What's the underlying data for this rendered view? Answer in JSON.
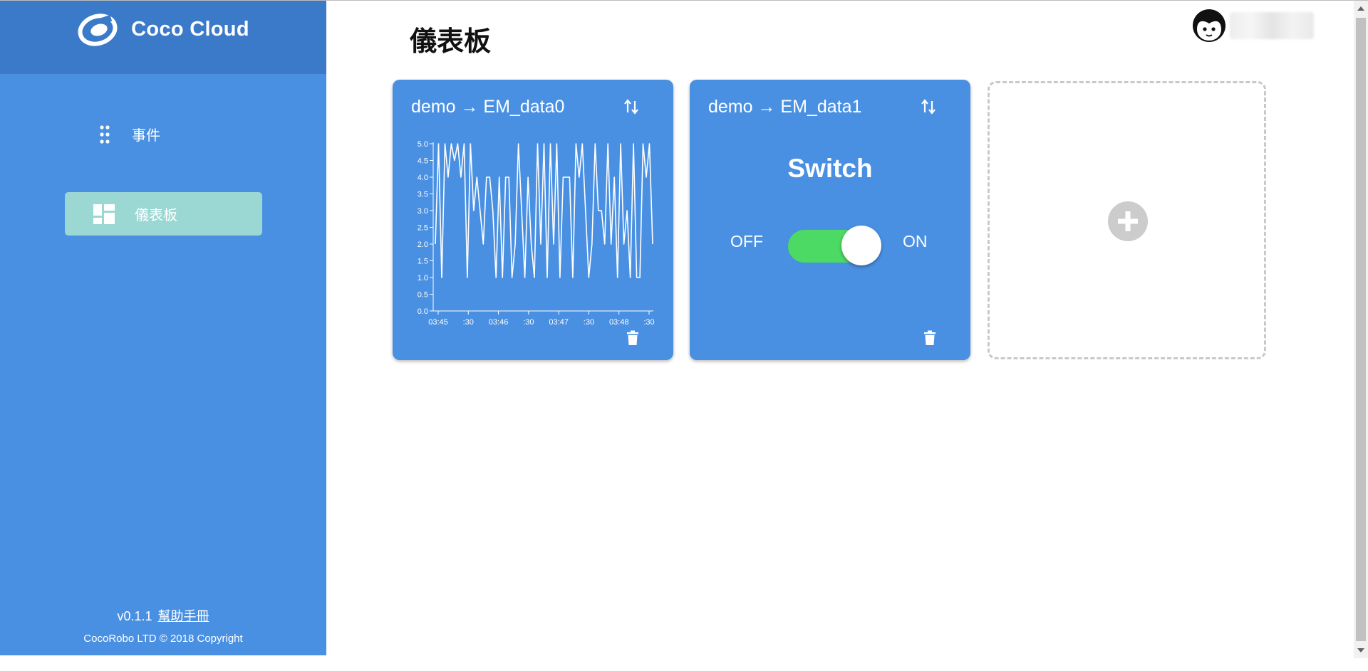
{
  "app": {
    "name": "Coco Cloud"
  },
  "sidebar": {
    "items": [
      {
        "label": "事件",
        "icon": "dots-grid-icon"
      },
      {
        "label": "儀表板",
        "icon": "dashboard-icon",
        "active": true
      }
    ],
    "version": "v0.1.1",
    "help_link": "幫助手冊",
    "copyright": "CocoRobo LTD © 2018 Copyright"
  },
  "header": {
    "title": "儀表板"
  },
  "widgets": [
    {
      "type": "chart",
      "title": "demo → EM_data0",
      "chart_data": {
        "type": "line",
        "y_ticks": [
          "0.0",
          "0.5",
          "1.0",
          "1.5",
          "2.0",
          "2.5",
          "3.0",
          "3.5",
          "4.0",
          "4.5",
          "5.0"
        ],
        "ylim": [
          0,
          5
        ],
        "x_ticks": [
          "03:45",
          ":30",
          "03:46",
          ":30",
          "03:47",
          ":30",
          "03:48",
          ":30"
        ],
        "series": [
          {
            "values": [
              2,
              5,
              1,
              5,
              4,
              5,
              4.5,
              5,
              4,
              5,
              1,
              5,
              3,
              4,
              3,
              2,
              4,
              4,
              3,
              1,
              4,
              1,
              4,
              4,
              1,
              2,
              5,
              3,
              1,
              4,
              2,
              1,
              5,
              2,
              5,
              1,
              5,
              2,
              5,
              1,
              4,
              4,
              4,
              1,
              5,
              4,
              5,
              3,
              1,
              2,
              5,
              3,
              3,
              2,
              5,
              2,
              4,
              1,
              5,
              2,
              3,
              1,
              5,
              1,
              1,
              5,
              4,
              5,
              2
            ]
          }
        ]
      }
    },
    {
      "type": "switch",
      "title": "demo → EM_data1",
      "heading": "Switch",
      "off_label": "OFF",
      "on_label": "ON",
      "state": "on"
    }
  ],
  "icons": {
    "swap": "swap-vertical-icon",
    "delete": "trash-icon",
    "add": "plus-circle-icon",
    "avatar": "avatar-face-icon",
    "logo": "coco-logo-icon"
  },
  "colors": {
    "sidebar": "#4a90e2",
    "brand_bar": "#3b7ac9",
    "active_nav": "#9bd8d4",
    "card": "#4a90e2",
    "toggle_on": "#4cd964",
    "add_icon": "#cccccc"
  }
}
